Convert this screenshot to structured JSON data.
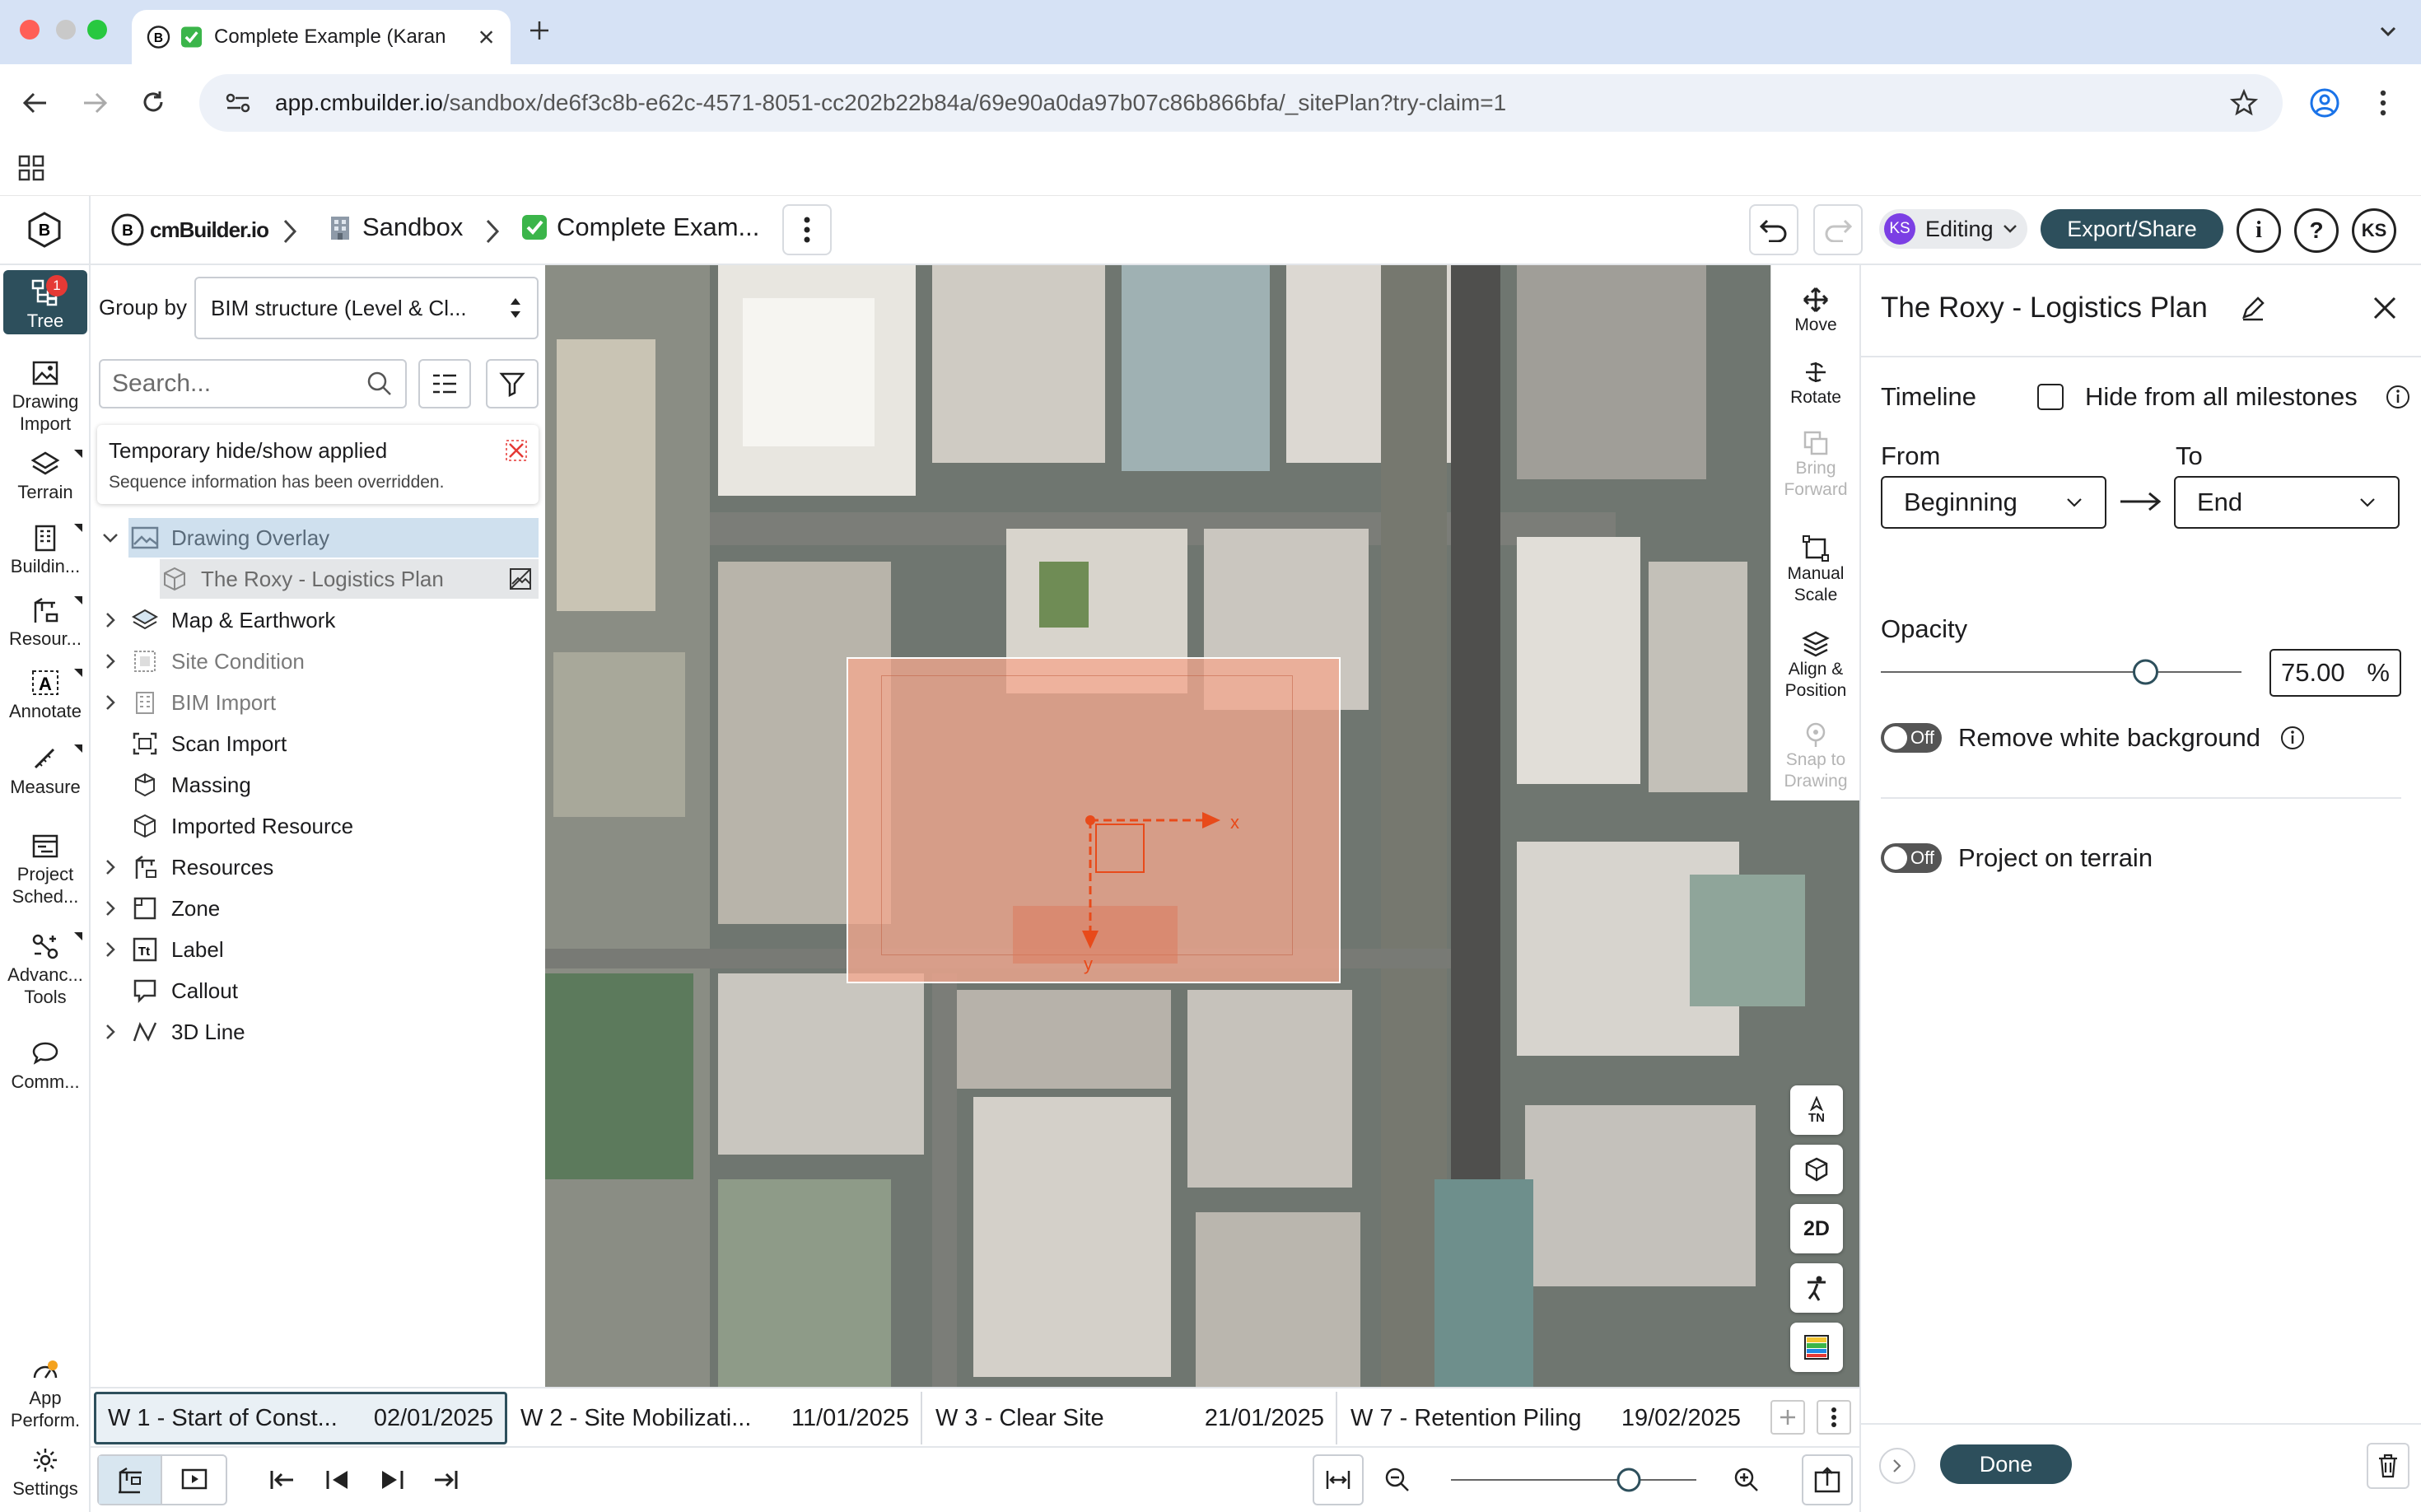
{
  "browser": {
    "tab_title": "Complete Example (Karan",
    "url_host": "app.cmbuilder.io",
    "url_path": "/sandbox/de6f3c8b-e62c-4571-8051-cc202b22b84a/69e90a0da97b07c86b866bfa/_sitePlan?try-claim=1"
  },
  "header": {
    "logo_text": "cmBuilder.io",
    "crumb1": "Sandbox",
    "crumb2": "Complete Exam...",
    "editing_initials": "KS",
    "editing_label": "Editing",
    "export_label": "Export/Share",
    "user_initials": "KS"
  },
  "rail": {
    "tree": "Tree",
    "tree_badge": "1",
    "drawing_import": "Drawing Import",
    "terrain": "Terrain",
    "buildings": "Buildin...",
    "resources": "Resour...",
    "annotate": "Annotate",
    "measure": "Measure",
    "project_schedule": "Project Sched...",
    "advanced_tools": "Advanc... Tools",
    "comments": "Comm...",
    "app_perf": "App Perform.",
    "settings": "Settings"
  },
  "tree": {
    "group_by_label": "Group by",
    "group_by_value": "BIM structure (Level & Cl...",
    "search_placeholder": "Search...",
    "notice_title": "Temporary hide/show applied",
    "notice_text": "Sequence information has been overridden.",
    "items": [
      {
        "label": "Drawing Overlay"
      },
      {
        "label": "The Roxy - Logistics Plan"
      },
      {
        "label": "Map & Earthwork"
      },
      {
        "label": "Site Condition"
      },
      {
        "label": "BIM Import"
      },
      {
        "label": "Scan Import"
      },
      {
        "label": "Massing"
      },
      {
        "label": "Imported Resource"
      },
      {
        "label": "Resources"
      },
      {
        "label": "Zone"
      },
      {
        "label": "Label"
      },
      {
        "label": "Callout"
      },
      {
        "label": "3D Line"
      }
    ]
  },
  "viewer_tools": {
    "move": "Move",
    "rotate": "Rotate",
    "bring_forward": "Bring Forward",
    "manual_scale": "Manual Scale",
    "align_position": "Align & Position",
    "snap_to_drawing": "Snap to Drawing",
    "north_label": "TN",
    "view_2d": "2D"
  },
  "overlay_marks": {
    "x_label": "x",
    "y_label": "y"
  },
  "milestones": [
    {
      "name": "W 1 - Start of Const...",
      "date": "02/01/2025"
    },
    {
      "name": "W 2 - Site Mobilizati...",
      "date": "11/01/2025"
    },
    {
      "name": "W 3 - Clear Site",
      "date": "21/01/2025"
    },
    {
      "name": "W 7 - Retention Piling",
      "date": "19/02/2025"
    }
  ],
  "panel": {
    "title": "The Roxy - Logistics Plan",
    "timeline_label": "Timeline",
    "hide_label": "Hide from all milestones",
    "from_label": "From",
    "to_label": "To",
    "from_value": "Beginning",
    "to_value": "End",
    "opacity_label": "Opacity",
    "opacity_value": "75.00",
    "opacity_unit": "%",
    "opacity_level": 0.75,
    "toggle_off": "Off",
    "remove_white_bg": "Remove white background",
    "project_on_terrain": "Project on terrain",
    "done_label": "Done"
  },
  "zoom_level": 0.75,
  "colors": {
    "accent": "#2d4f5c",
    "badge": "#e53935",
    "editing": "#7b3fe4",
    "tree_selected": "#cfe0ee",
    "overlay": "#f3a88f"
  }
}
